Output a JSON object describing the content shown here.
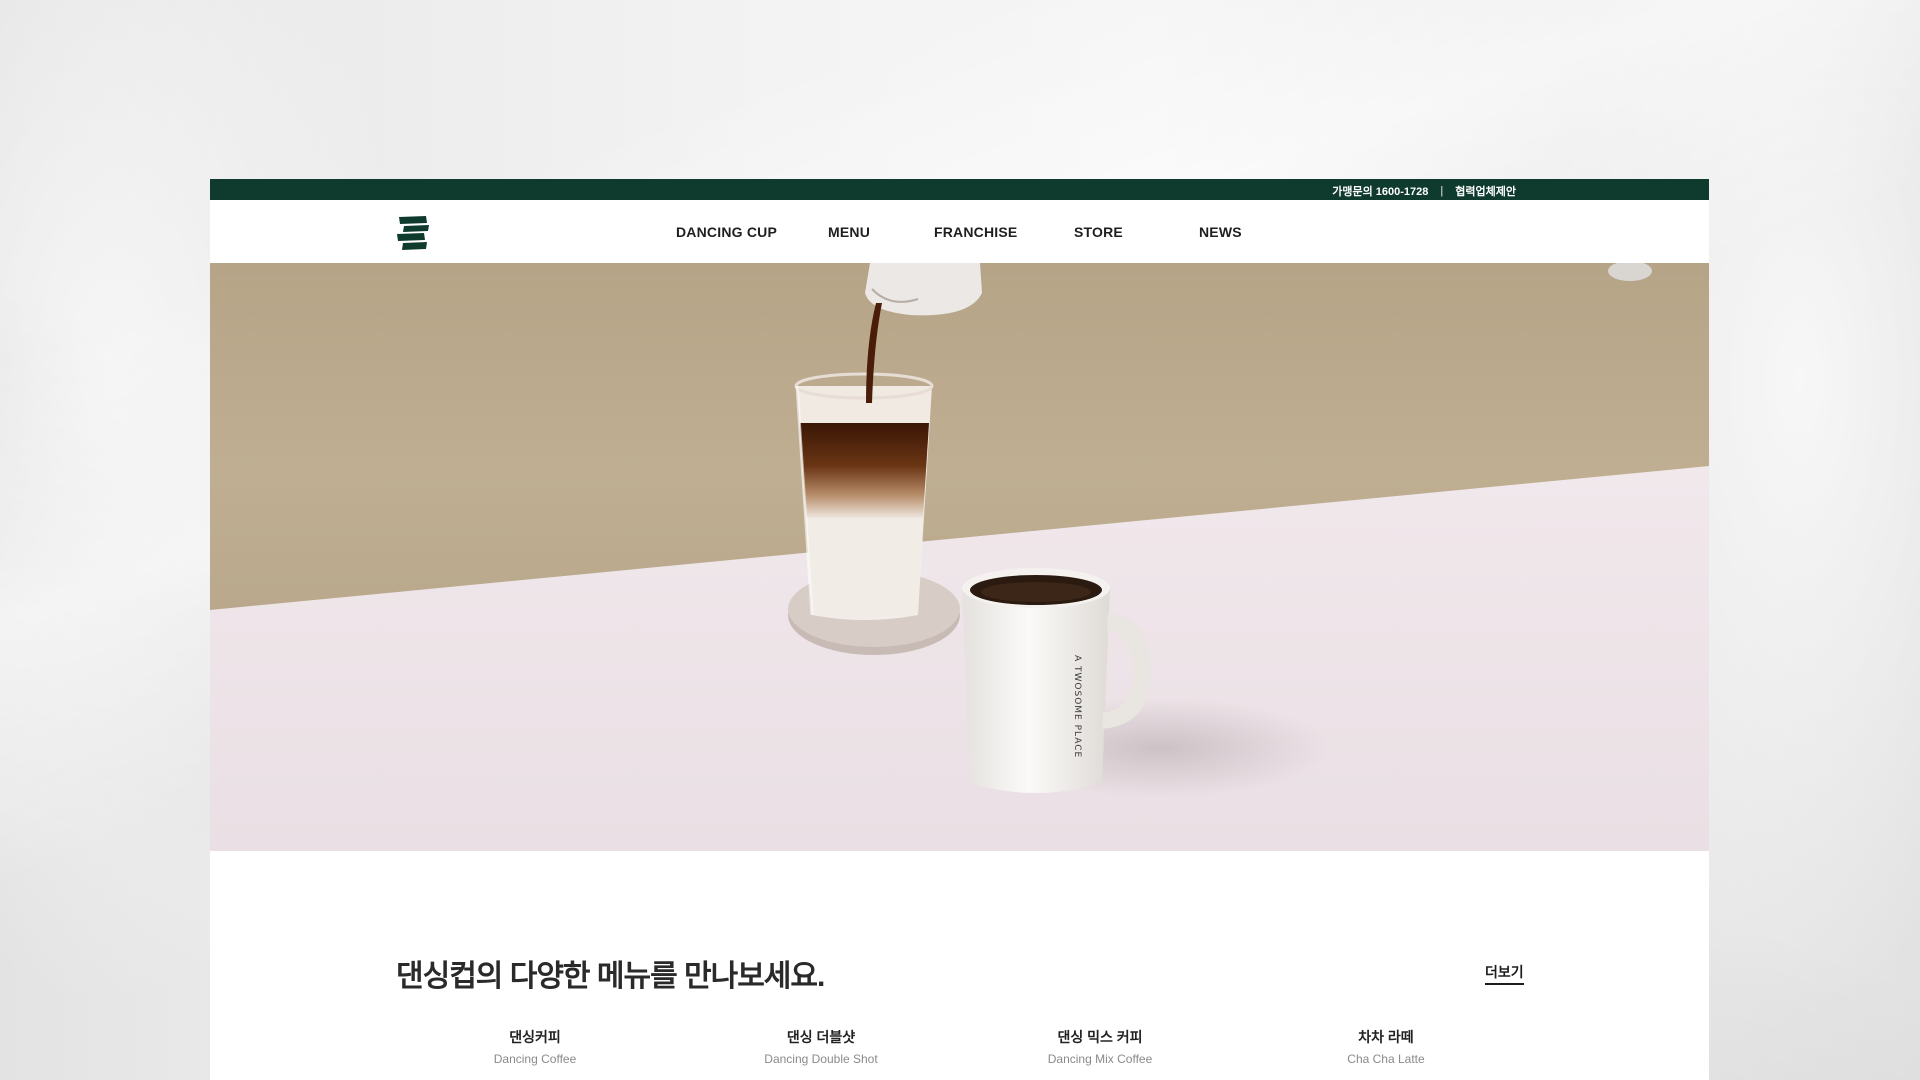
{
  "topbar": {
    "franchise_inquiry": "가맹문의 1600-1728",
    "separator": "|",
    "partner_proposal": "협력업체제안"
  },
  "nav": {
    "items": [
      {
        "label": "DANCING CUP"
      },
      {
        "label": "MENU"
      },
      {
        "label": "FRANCHISE"
      },
      {
        "label": "STORE"
      },
      {
        "label": "NEWS"
      }
    ]
  },
  "hero": {
    "mug_text": "A TWOSOME PLACE"
  },
  "menu_section": {
    "title": "댄싱컵의 다양한 메뉴를 만나보세요.",
    "more_label": "더보기",
    "items": [
      {
        "name_ko": "댄싱커피",
        "name_en": "Dancing Coffee"
      },
      {
        "name_ko": "댄싱 더블샷",
        "name_en": "Dancing Double Shot"
      },
      {
        "name_ko": "댄싱 믹스 커피",
        "name_en": "Dancing Mix Coffee"
      },
      {
        "name_ko": "차차 라떼",
        "name_en": "Cha Cha Latte"
      }
    ]
  },
  "colors": {
    "brand_green": "#0f3b2e",
    "hero_wall": "#b6a487",
    "hero_table": "#ede4e8"
  }
}
